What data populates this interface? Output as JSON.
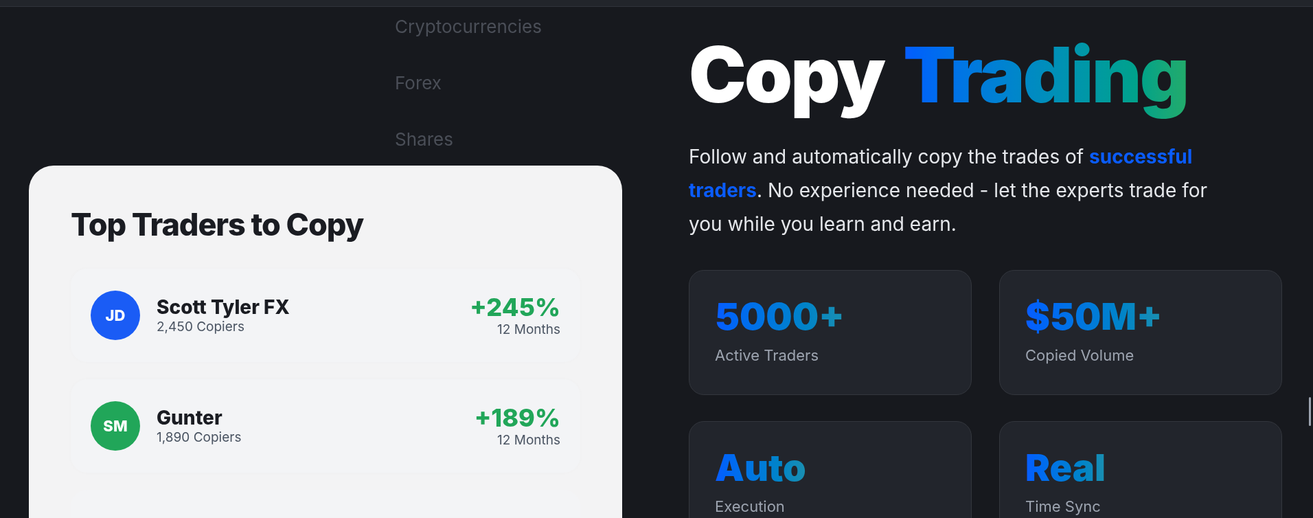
{
  "background_labels": [
    "Cryptocurrencies",
    "Forex",
    "Shares"
  ],
  "card": {
    "title": "Top Traders to Copy",
    "traders": [
      {
        "initials": "JD",
        "name": "Scott Tyler FX",
        "copiers": "2,450 Copiers",
        "return": "+245%",
        "period": "12 Months",
        "color": "#1a5cf5"
      },
      {
        "initials": "SM",
        "name": "Gunter",
        "copiers": "1,890 Copiers",
        "return": "+189%",
        "period": "12 Months",
        "color": "#21a659"
      }
    ]
  },
  "hero": {
    "title_plain": "Copy",
    "title_gradient": "Trading",
    "description": "Follow and automatically copy the trades of **successful traders**. No experience needed - let the experts trade for you while you learn and earn."
  },
  "stats": [
    {
      "value": "5000+",
      "label": "Active Traders"
    },
    {
      "value": "$50M+",
      "label": "Copied Volume"
    },
    {
      "value": "Auto",
      "label": "Execution"
    },
    {
      "value": "Real",
      "label": "Time Sync"
    }
  ]
}
